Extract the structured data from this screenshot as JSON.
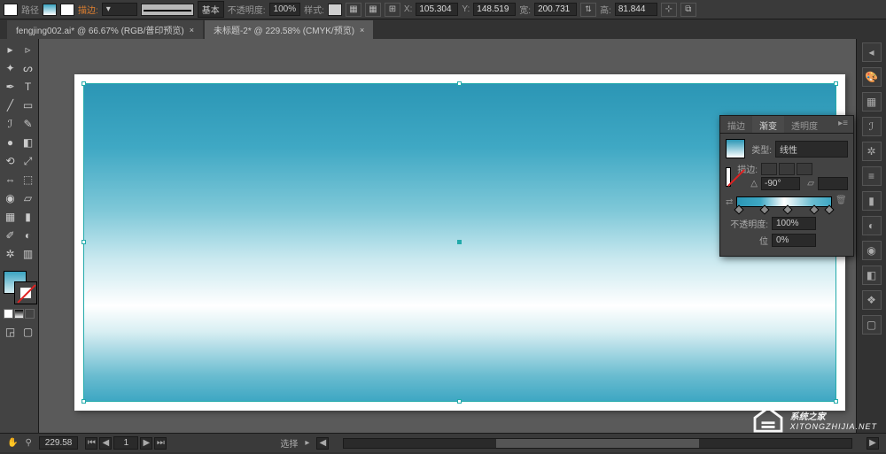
{
  "control_bar": {
    "path_label": "路径",
    "stroke_label": "描边:",
    "stroke_style": "基本",
    "opacity_label": "不透明度:",
    "opacity_value": "100%",
    "style_label": "样式:",
    "x_label": "X:",
    "x_value": "105.304",
    "y_label": "Y:",
    "y_value": "148.519",
    "w_label": "宽:",
    "w_value": "200.731",
    "h_label": "高:",
    "h_value": "81.844"
  },
  "tabs": [
    {
      "label": "fengjing002.ai* @ 66.67% (RGB/普印预览)",
      "active": false
    },
    {
      "label": "未标题-2* @ 229.58% (CMYK/预览)",
      "active": true
    }
  ],
  "gradient_panel": {
    "tabs": {
      "stroke": "描边",
      "gradient": "渐变",
      "transparency": "透明度"
    },
    "type_label": "类型:",
    "type_value": "线性",
    "stroke_label": "描边:",
    "angle_label": "△",
    "angle_value": "-90°",
    "ratio_value": "",
    "opacity_label": "不透明度:",
    "opacity_value": "100%",
    "position_label": "位",
    "position_value": "0%"
  },
  "status_bar": {
    "zoom_value": "229.58",
    "artboard_nav": "1",
    "tool_label": "选择"
  },
  "watermark": {
    "title": "系统之家",
    "url": "XITONGZHIJIA.NET"
  },
  "chart_data": {
    "type": "area",
    "note": "Linear gradient fill applied to a rectangle in Illustrator canvas",
    "angle": -90,
    "stops": [
      {
        "position": 0,
        "color": "#2b96b5"
      },
      {
        "position": 25,
        "color": "#3fa8c4"
      },
      {
        "position": 50,
        "color": "#ffffff"
      },
      {
        "position": 78,
        "color": "#6abcd0"
      },
      {
        "position": 100,
        "color": "#3ea7c3"
      }
    ]
  }
}
